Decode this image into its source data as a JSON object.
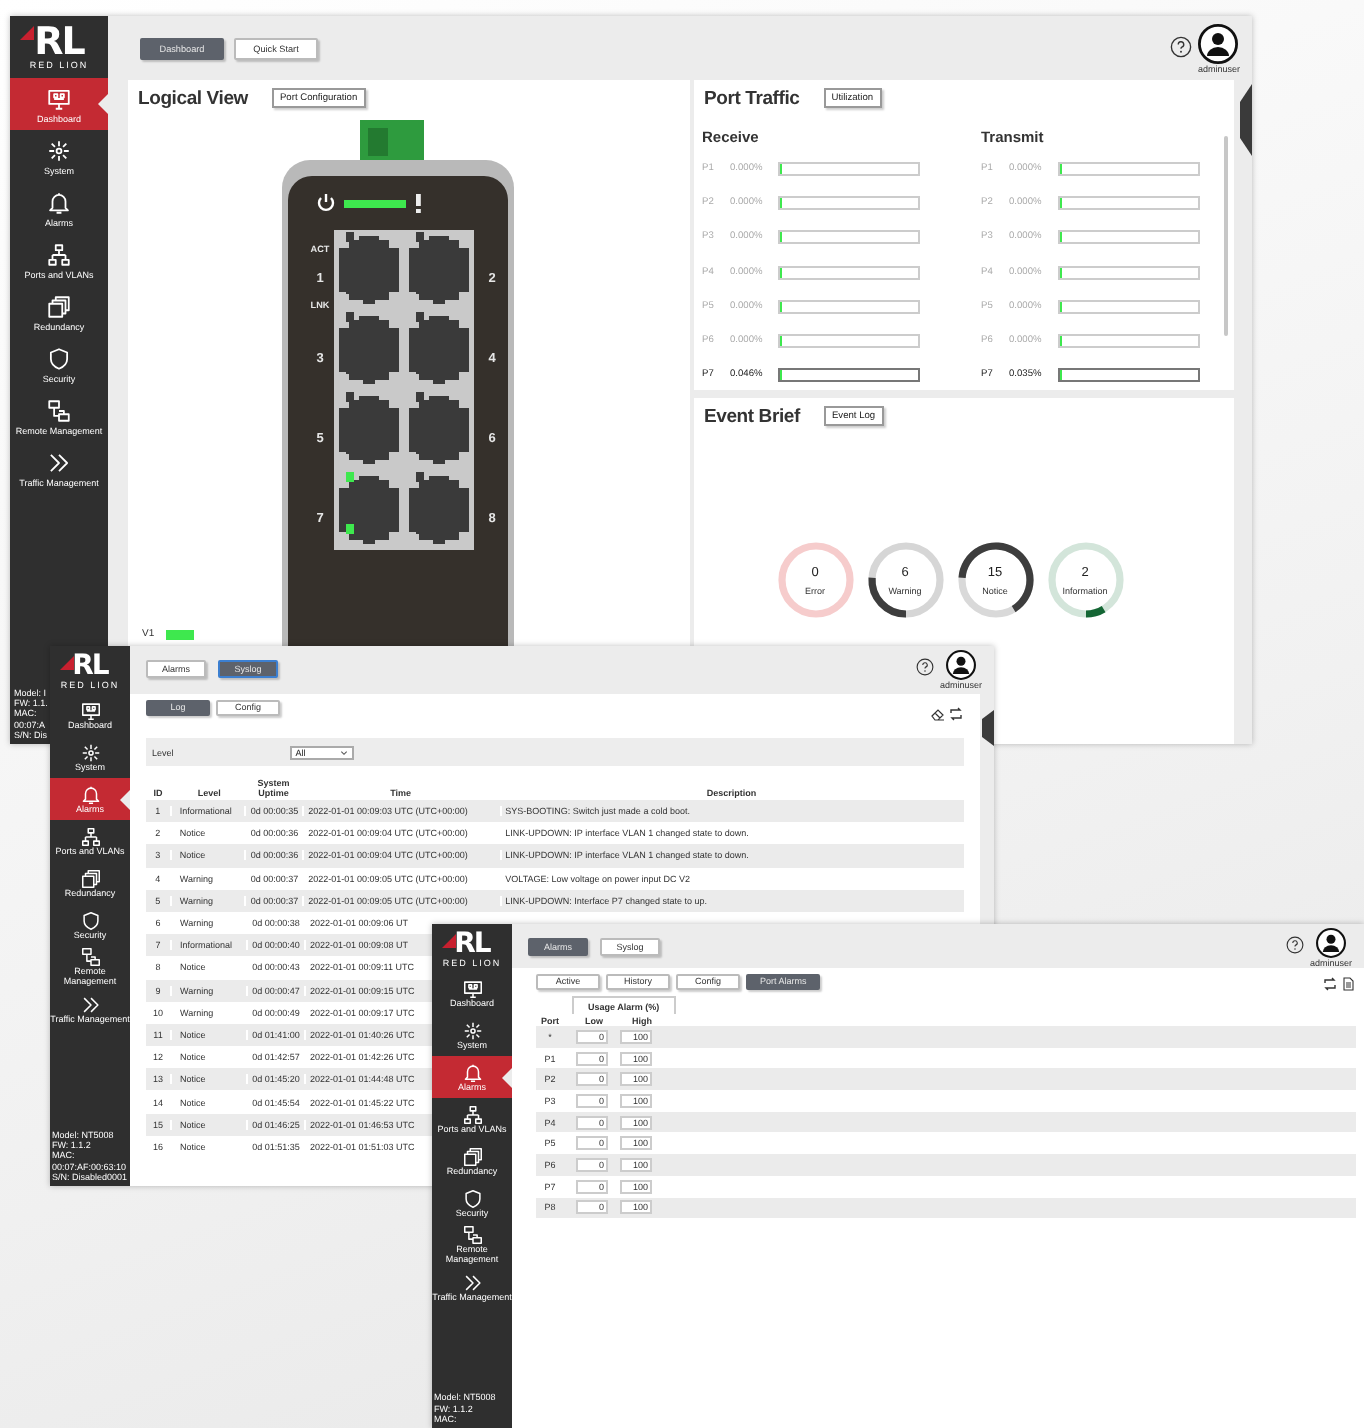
{
  "windows": [
    {
      "kind": "dashboard",
      "logo": {
        "mark": "RL",
        "name": "RED LION"
      },
      "sidebar": {
        "items": [
          {
            "label": "Dashboard",
            "selected": true
          },
          {
            "label": "System",
            "selected": false
          },
          {
            "label": "Alarms",
            "selected": false
          },
          {
            "label": "Ports and VLANs",
            "selected": false
          },
          {
            "label": "Redundancy",
            "selected": false
          },
          {
            "label": "Security",
            "selected": false
          },
          {
            "label": "Remote Management",
            "selected": false
          },
          {
            "label": "Traffic Management",
            "selected": false
          }
        ],
        "device_info": [
          "Model: I",
          "FW: 1.1.",
          "MAC:",
          "00:07:A",
          "S/N: Dis"
        ]
      },
      "top_tabs": [
        {
          "label": "Dashboard",
          "selected": true
        },
        {
          "label": "Quick Start",
          "selected": false
        }
      ],
      "user": "adminuser",
      "logical_view": {
        "title": "Logical View",
        "button": "Port Configuration",
        "side_labels": [
          "ACT",
          "LNK"
        ],
        "version_label": "V1",
        "ports": [
          {
            "label": "1",
            "link": false
          },
          {
            "label": "2",
            "link": false
          },
          {
            "label": "3",
            "link": false
          },
          {
            "label": "4",
            "link": false
          },
          {
            "label": "5",
            "link": false
          },
          {
            "label": "6",
            "link": false
          },
          {
            "label": "7",
            "link": true
          },
          {
            "label": "8",
            "link": false
          }
        ]
      },
      "port_traffic": {
        "title": "Port Traffic",
        "button": "Utilization",
        "receive": {
          "title": "Receive",
          "rows": [
            {
              "port": "P1",
              "value": "0.000%",
              "level": 0,
              "active": false
            },
            {
              "port": "P2",
              "value": "0.000%",
              "level": 0,
              "active": false
            },
            {
              "port": "P3",
              "value": "0.000%",
              "level": 0,
              "active": false
            },
            {
              "port": "P4",
              "value": "0.000%",
              "level": 0,
              "active": false
            },
            {
              "port": "P5",
              "value": "0.000%",
              "level": 0,
              "active": false
            },
            {
              "port": "P6",
              "value": "0.000%",
              "level": 0,
              "active": false
            },
            {
              "port": "P7",
              "value": "0.046%",
              "level": 0.00046,
              "active": true
            }
          ]
        },
        "transmit": {
          "title": "Transmit",
          "rows": [
            {
              "port": "P1",
              "value": "0.000%",
              "level": 0,
              "active": false
            },
            {
              "port": "P2",
              "value": "0.000%",
              "level": 0,
              "active": false
            },
            {
              "port": "P3",
              "value": "0.000%",
              "level": 0,
              "active": false
            },
            {
              "port": "P4",
              "value": "0.000%",
              "level": 0,
              "active": false
            },
            {
              "port": "P5",
              "value": "0.000%",
              "level": 0,
              "active": false
            },
            {
              "port": "P6",
              "value": "0.000%",
              "level": 0,
              "active": false
            },
            {
              "port": "P7",
              "value": "0.035%",
              "level": 0.00035,
              "active": true
            }
          ]
        }
      },
      "event_brief": {
        "title": "Event Brief",
        "button": "Event Log",
        "items": [
          {
            "count": "0",
            "label": "Error",
            "color": "#f6cccc"
          },
          {
            "count": "6",
            "label": "Warning",
            "color": "#d6d6d6"
          },
          {
            "count": "15",
            "label": "Notice",
            "color": "#d9d9d9"
          },
          {
            "count": "2",
            "label": "Information",
            "color": "#d3e5da"
          }
        ]
      }
    },
    {
      "kind": "syslog",
      "logo": {
        "mark": "RL",
        "name": "RED LION"
      },
      "sidebar": {
        "items": [
          {
            "label": "Dashboard",
            "selected": false
          },
          {
            "label": "System",
            "selected": false
          },
          {
            "label": "Alarms",
            "selected": true
          },
          {
            "label": "Ports and VLANs",
            "selected": false
          },
          {
            "label": "Redundancy",
            "selected": false
          },
          {
            "label": "Security",
            "selected": false
          },
          {
            "label": "Remote Management",
            "selected": false
          },
          {
            "label": "Traffic Management",
            "selected": false
          }
        ],
        "device_info": [
          "Model: NT5008",
          "FW: 1.1.2",
          "MAC:",
          "00:07:AF:00:63:10",
          "S/N: Disabled0001"
        ]
      },
      "top_tabs": [
        {
          "label": "Alarms",
          "selected": false
        },
        {
          "label": "Syslog",
          "selected": true
        }
      ],
      "user": "adminuser",
      "sub_tabs": [
        {
          "label": "Log",
          "selected": true
        },
        {
          "label": "Config",
          "selected": false
        }
      ],
      "filter": {
        "label": "Level",
        "value": "All"
      },
      "columns": [
        "ID",
        "Level",
        "System Uptime",
        "Time",
        "Description"
      ],
      "rows": [
        {
          "id": "1",
          "level": "Informational",
          "uptime": "0d 00:00:35",
          "time": "2022-01-01 00:09:03 UTC (UTC+00:00)",
          "description": "SYS-BOOTING: Switch just made a cold boot."
        },
        {
          "id": "2",
          "level": "Notice",
          "uptime": "0d 00:00:36",
          "time": "2022-01-01 00:09:04 UTC (UTC+00:00)",
          "description": "LINK-UPDOWN: IP interface VLAN 1 changed state to down."
        },
        {
          "id": "3",
          "level": "Notice",
          "uptime": "0d 00:00:36",
          "time": "2022-01-01 00:09:04 UTC (UTC+00:00)",
          "description": "LINK-UPDOWN: IP interface VLAN 1 changed state to down."
        },
        {
          "id": "4",
          "level": "Warning",
          "uptime": "0d 00:00:37",
          "time": "2022-01-01 00:09:05 UTC (UTC+00:00)",
          "description": "VOLTAGE: Low voltage on power input DC V2"
        },
        {
          "id": "5",
          "level": "Warning",
          "uptime": "0d 00:00:37",
          "time": "2022-01-01 00:09:05 UTC (UTC+00:00)",
          "description": "LINK-UPDOWN: Interface P7 changed state to up."
        },
        {
          "id": "6",
          "level": "Warning",
          "uptime": "0d 00:00:38",
          "time": "2022-01-01 00:09:06 UT"
        },
        {
          "id": "7",
          "level": "Informational",
          "uptime": "0d 00:00:40",
          "time": "2022-01-01 00:09:08 UT"
        },
        {
          "id": "8",
          "level": "Notice",
          "uptime": "0d 00:00:43",
          "time": "2022-01-01 00:09:11 UTC"
        },
        {
          "id": "9",
          "level": "Warning",
          "uptime": "0d 00:00:47",
          "time": "2022-01-01 00:09:15 UTC"
        },
        {
          "id": "10",
          "level": "Warning",
          "uptime": "0d 00:00:49",
          "time": "2022-01-01 00:09:17 UTC"
        },
        {
          "id": "11",
          "level": "Notice",
          "uptime": "0d 01:41:00",
          "time": "2022-01-01 01:40:26 UTC"
        },
        {
          "id": "12",
          "level": "Notice",
          "uptime": "0d 01:42:57",
          "time": "2022-01-01 01:42:26 UTC"
        },
        {
          "id": "13",
          "level": "Notice",
          "uptime": "0d 01:45:20",
          "time": "2022-01-01 01:44:48 UTC"
        },
        {
          "id": "14",
          "level": "Notice",
          "uptime": "0d 01:45:54",
          "time": "2022-01-01 01:45:22 UTC"
        },
        {
          "id": "15",
          "level": "Notice",
          "uptime": "0d 01:46:25",
          "time": "2022-01-01 01:46:53 UTC"
        },
        {
          "id": "16",
          "level": "Notice",
          "uptime": "0d 01:51:35",
          "time": "2022-01-01 01:51:03 UTC"
        }
      ]
    },
    {
      "kind": "port_alarms",
      "logo": {
        "mark": "RL",
        "name": "RED LION"
      },
      "sidebar": {
        "items": [
          {
            "label": "Dashboard",
            "selected": false
          },
          {
            "label": "System",
            "selected": false
          },
          {
            "label": "Alarms",
            "selected": true
          },
          {
            "label": "Ports and VLANs",
            "selected": false
          },
          {
            "label": "Redundancy",
            "selected": false
          },
          {
            "label": "Security",
            "selected": false
          },
          {
            "label": "Remote Management",
            "selected": false
          },
          {
            "label": "Traffic Management",
            "selected": false
          }
        ],
        "device_info": [
          "Model: NT5008",
          "FW: 1.1.2",
          "MAC:"
        ]
      },
      "top_tabs": [
        {
          "label": "Alarms",
          "selected": true
        },
        {
          "label": "Syslog",
          "selected": false
        }
      ],
      "user": "adminuser",
      "sub_tabs": [
        {
          "label": "Active",
          "selected": false
        },
        {
          "label": "History",
          "selected": false
        },
        {
          "label": "Config",
          "selected": false
        },
        {
          "label": "Port Alarms",
          "selected": true
        }
      ],
      "group_header": "Usage Alarm (%)",
      "columns": [
        "Port",
        "Low",
        "High"
      ],
      "rows": [
        {
          "port": "*",
          "low": "0",
          "high": "100"
        },
        {
          "port": "P1",
          "low": "0",
          "high": "100"
        },
        {
          "port": "P2",
          "low": "0",
          "high": "100"
        },
        {
          "port": "P3",
          "low": "0",
          "high": "100"
        },
        {
          "port": "P4",
          "low": "0",
          "high": "100"
        },
        {
          "port": "P5",
          "low": "0",
          "high": "100"
        },
        {
          "port": "P6",
          "low": "0",
          "high": "100"
        },
        {
          "port": "P7",
          "low": "0",
          "high": "100"
        },
        {
          "port": "P8",
          "low": "0",
          "high": "100"
        }
      ]
    }
  ]
}
